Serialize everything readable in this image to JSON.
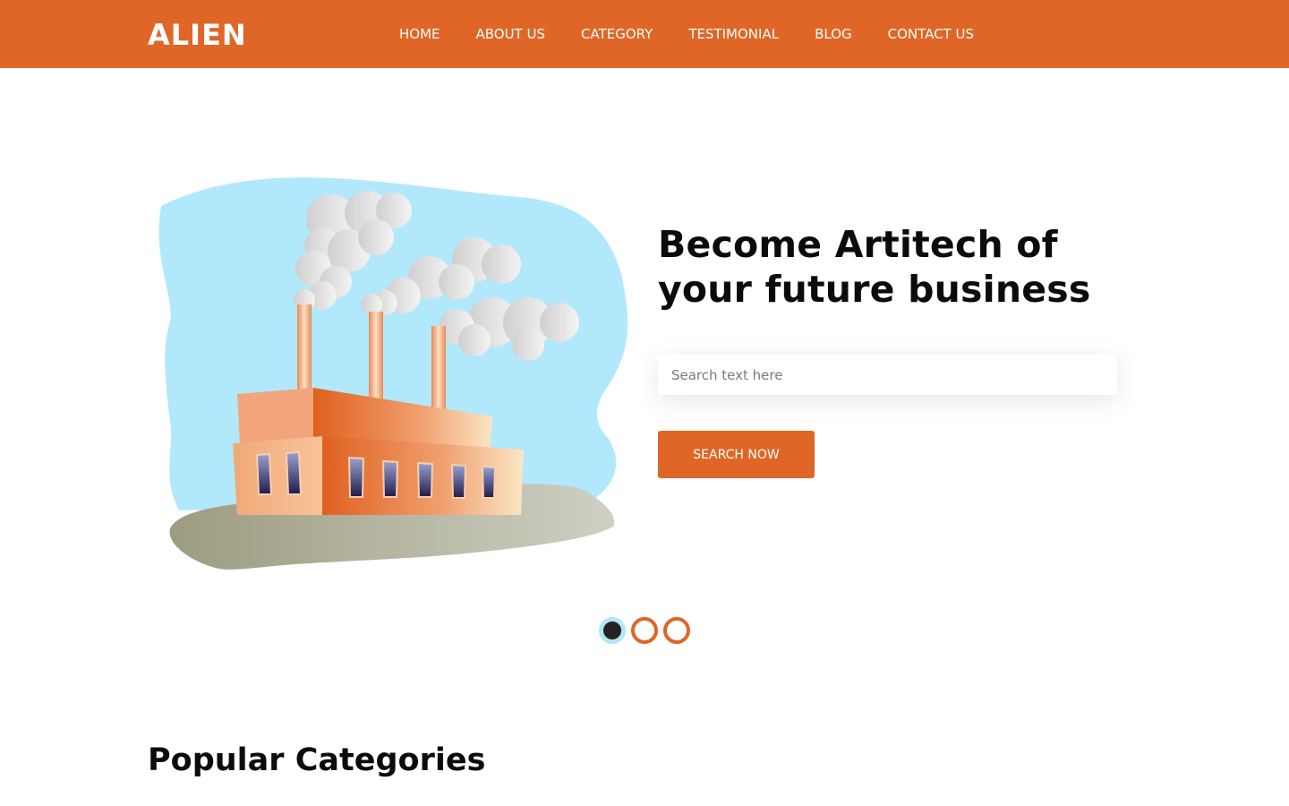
{
  "brand": {
    "logo": "ALIEN",
    "accent_color": "#df6626"
  },
  "nav": {
    "items": [
      "HOME",
      "ABOUT US",
      "CATEGORY",
      "TESTIMONIAL",
      "BLOG",
      "CONTACT US"
    ]
  },
  "hero": {
    "title_line1": "Become Artitech of",
    "title_line2": "your future business",
    "illustration": "factory-illustration",
    "search": {
      "placeholder": "Search text here",
      "value": ""
    },
    "button_label": "SEARCH NOW"
  },
  "carousel": {
    "slide_count": 3,
    "active_index": 0
  },
  "sections": {
    "popular_title": "Popular Categories"
  }
}
